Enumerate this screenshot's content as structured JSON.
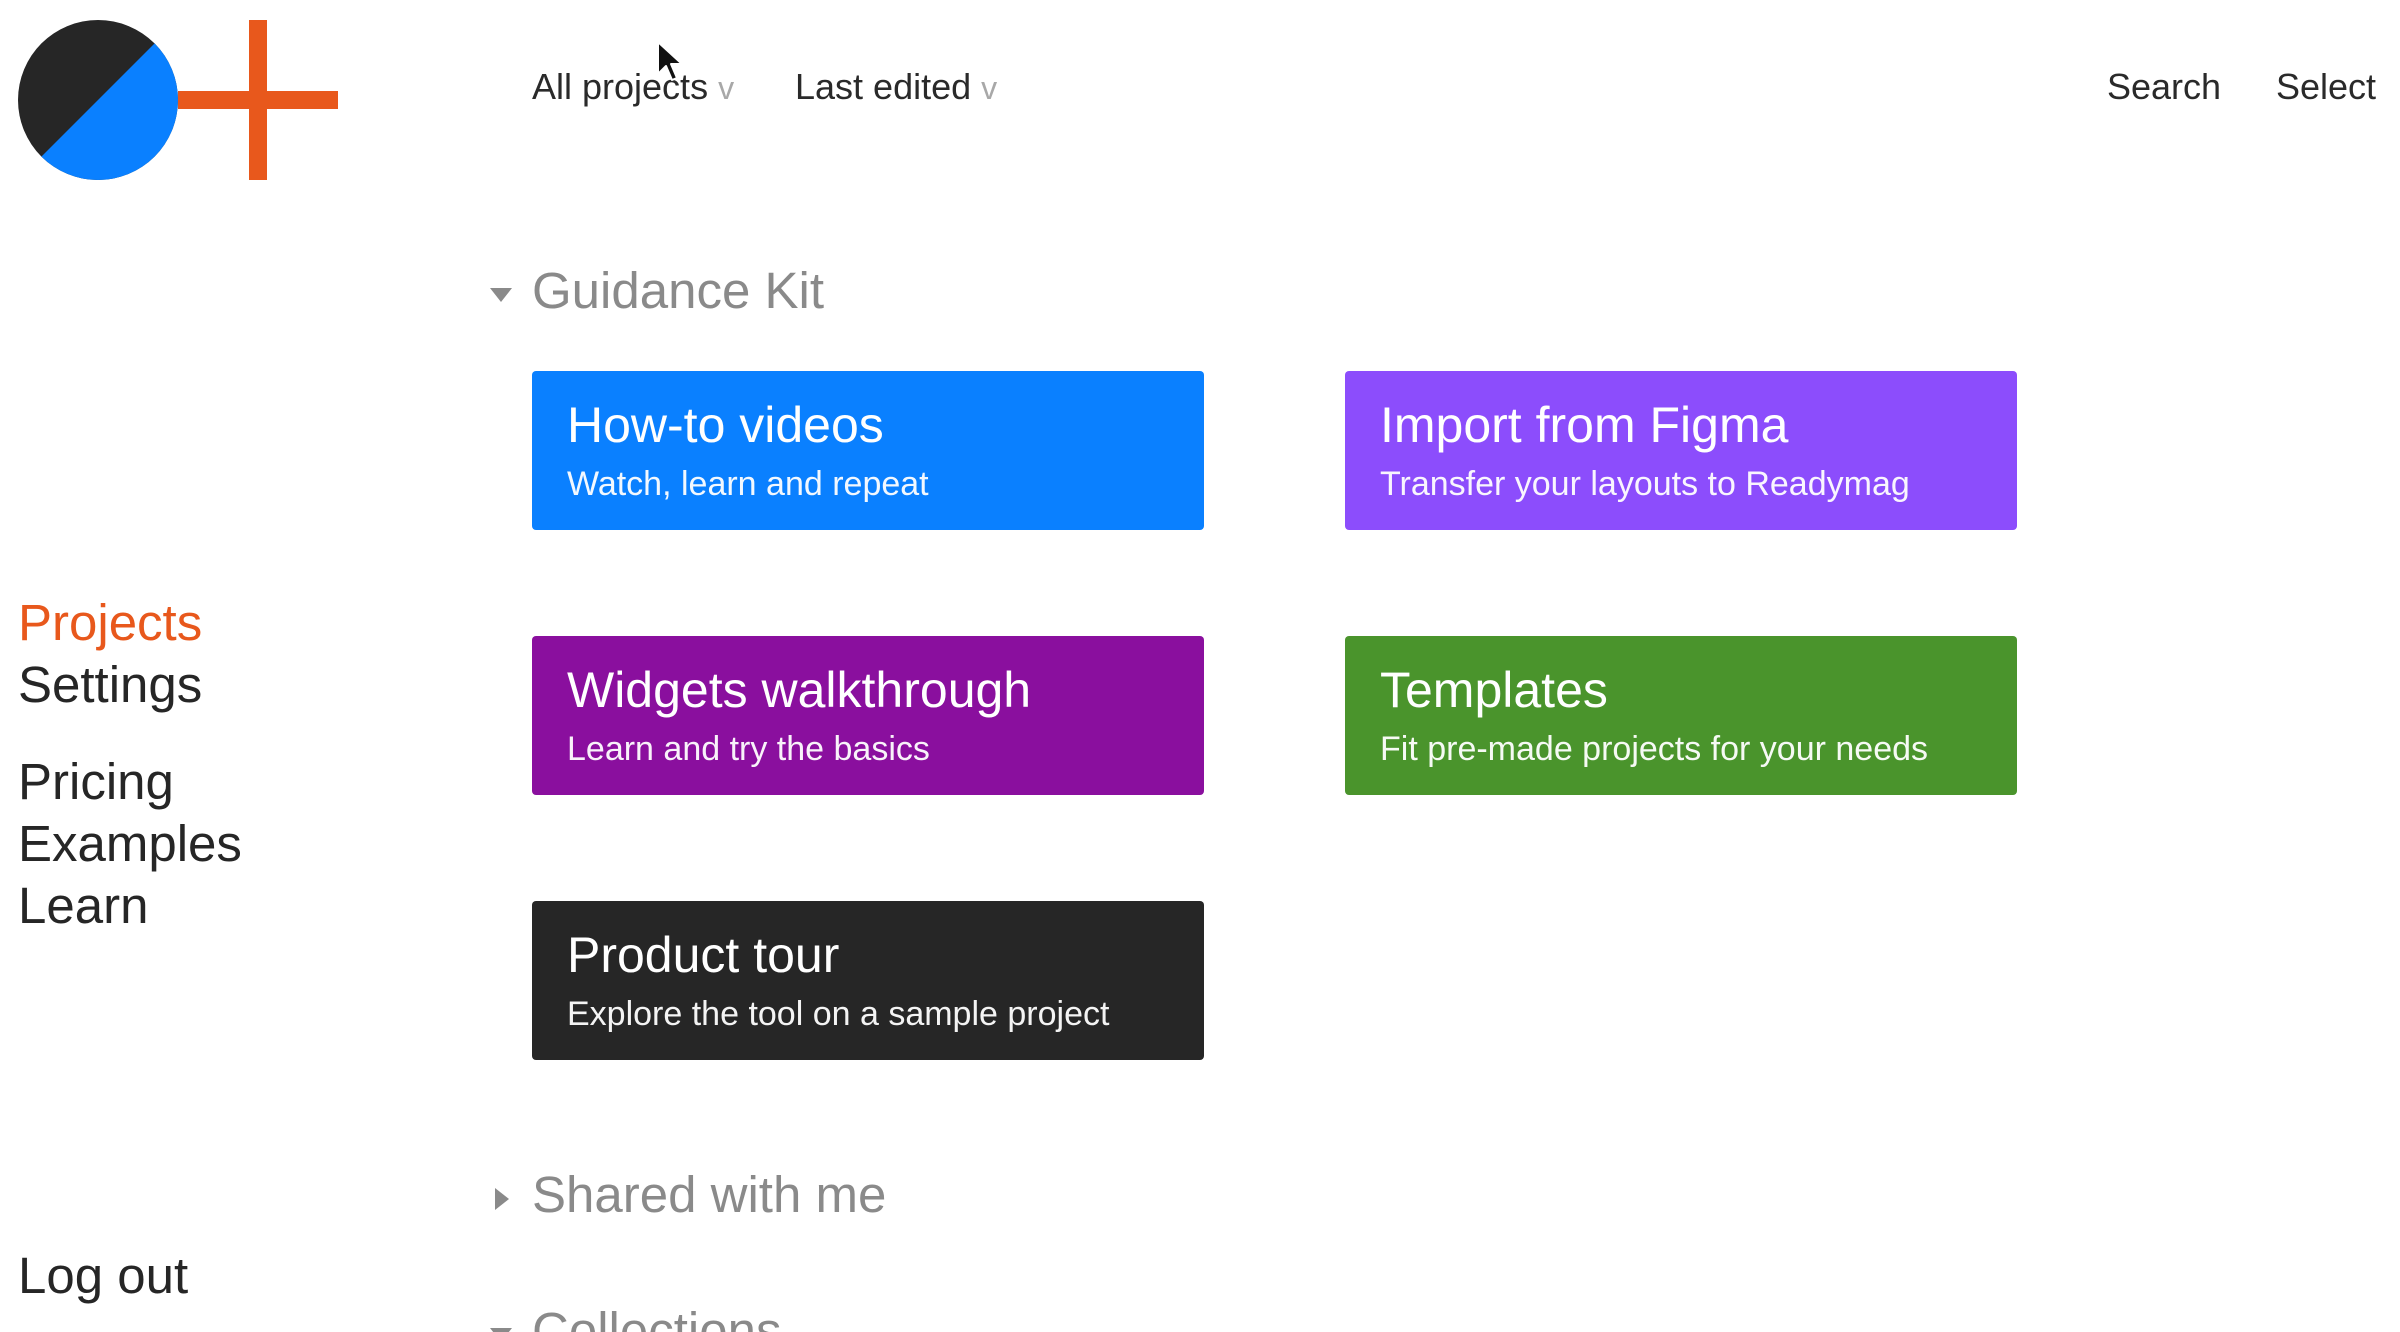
{
  "colors": {
    "accent": "#e8581c",
    "logo_dark": "#262626",
    "logo_blue": "#0a80ff",
    "muted": "#8a8a8a"
  },
  "sidebar": {
    "items": [
      {
        "label": "Projects",
        "active": true
      },
      {
        "label": "Settings",
        "active": false
      },
      {
        "label": "Pricing",
        "active": false
      },
      {
        "label": "Examples",
        "active": false
      },
      {
        "label": "Learn",
        "active": false
      }
    ],
    "logout_label": "Log out"
  },
  "topbar": {
    "filter_projects": {
      "label": "All projects",
      "chevron": "v"
    },
    "filter_sort": {
      "label": "Last edited",
      "chevron": "v"
    },
    "search_label": "Search",
    "select_label": "Select"
  },
  "sections": {
    "guidance_kit": {
      "title": "Guidance Kit",
      "expanded": true,
      "cards": [
        {
          "title": "How-to videos",
          "subtitle": "Watch, learn and repeat",
          "color": "#0a80ff"
        },
        {
          "title": "Import from Figma",
          "subtitle": "Transfer your layouts to Readymag",
          "color": "#8c4dfc"
        },
        {
          "title": "Widgets walkthrough",
          "subtitle": "Learn and try the basics",
          "color": "#8a0f9e"
        },
        {
          "title": "Templates",
          "subtitle": "Fit pre-made projects for your needs",
          "color": "#4a942c"
        },
        {
          "title": "Product tour",
          "subtitle": "Explore the tool on a sample project",
          "color": "#262626"
        }
      ]
    },
    "shared": {
      "title": "Shared with me",
      "expanded": false
    },
    "collections": {
      "title": "Collections",
      "expanded": true
    }
  }
}
